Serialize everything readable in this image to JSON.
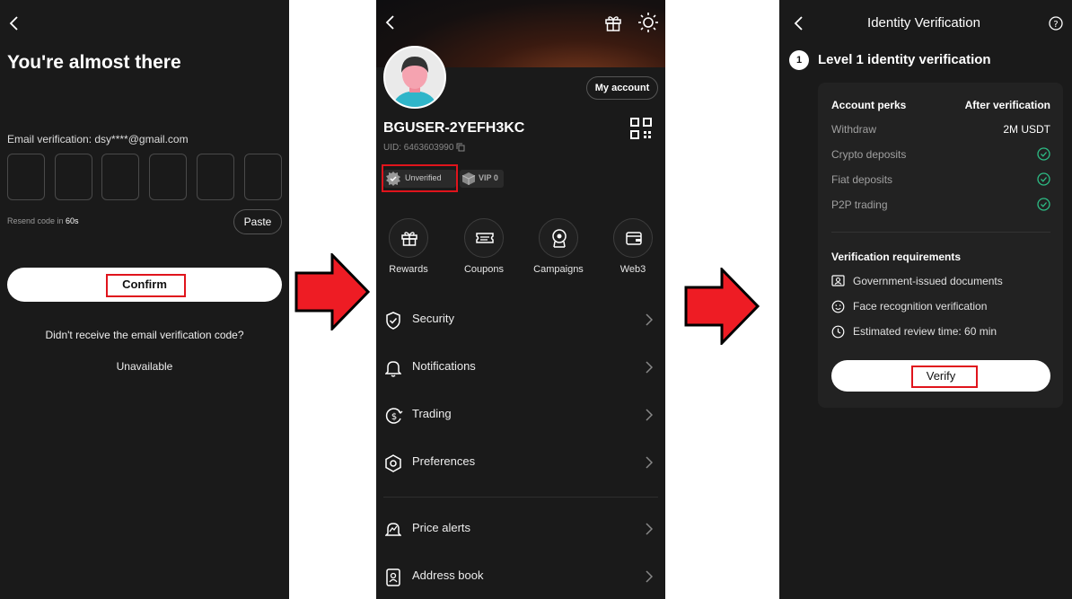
{
  "panel1": {
    "title": "You're almost there",
    "email_label": "Email verification: dsy****@gmail.com",
    "resend_prefix": "Resend code in ",
    "resend_seconds": "60s",
    "paste_label": "Paste",
    "confirm_label": "Confirm",
    "no_code_text": "Didn't receive the email verification code?",
    "unavailable_text": "Unavailable"
  },
  "panel2": {
    "my_account_label": "My account",
    "username": "BGUSER-2YEFH3KC",
    "uid": "UID: 6463603990",
    "unverified_label": "Unverified",
    "vip_label": "VIP 0",
    "actions": [
      {
        "label": "Rewards",
        "icon": "gift-icon"
      },
      {
        "label": "Coupons",
        "icon": "coupon-icon"
      },
      {
        "label": "Campaigns",
        "icon": "campaign-icon"
      },
      {
        "label": "Web3",
        "icon": "wallet-icon"
      }
    ],
    "menu": [
      {
        "label": "Security",
        "icon": "shield-icon"
      },
      {
        "label": "Notifications",
        "icon": "bell-icon"
      },
      {
        "label": "Trading",
        "icon": "dollar-icon"
      },
      {
        "label": "Preferences",
        "icon": "hexagon-icon"
      },
      {
        "label": "Price alerts",
        "icon": "alert-bell-icon"
      },
      {
        "label": "Address book",
        "icon": "address-book-icon"
      }
    ]
  },
  "panel3": {
    "title": "Identity Verification",
    "step_number": "1",
    "step_title": "Level 1 identity verification",
    "perks_header": "Account perks",
    "after_header": "After verification",
    "perks": [
      {
        "label": "Withdraw",
        "value": "2M USDT"
      },
      {
        "label": "Crypto deposits",
        "value": ""
      },
      {
        "label": "Fiat deposits",
        "value": ""
      },
      {
        "label": "P2P trading",
        "value": ""
      }
    ],
    "requirements_header": "Verification requirements",
    "requirements": [
      {
        "label": "Government-issued documents",
        "icon": "id-card-icon"
      },
      {
        "label": "Face recognition verification",
        "icon": "face-icon"
      },
      {
        "label": "Estimated review time: 60 min",
        "icon": "clock-icon"
      }
    ],
    "verify_label": "Verify"
  },
  "colors": {
    "background": "#1a1a1a",
    "card": "#222222",
    "highlight_red": "#e0141c",
    "check_green": "#2dbd85",
    "arrow_red": "#ee1c24"
  }
}
